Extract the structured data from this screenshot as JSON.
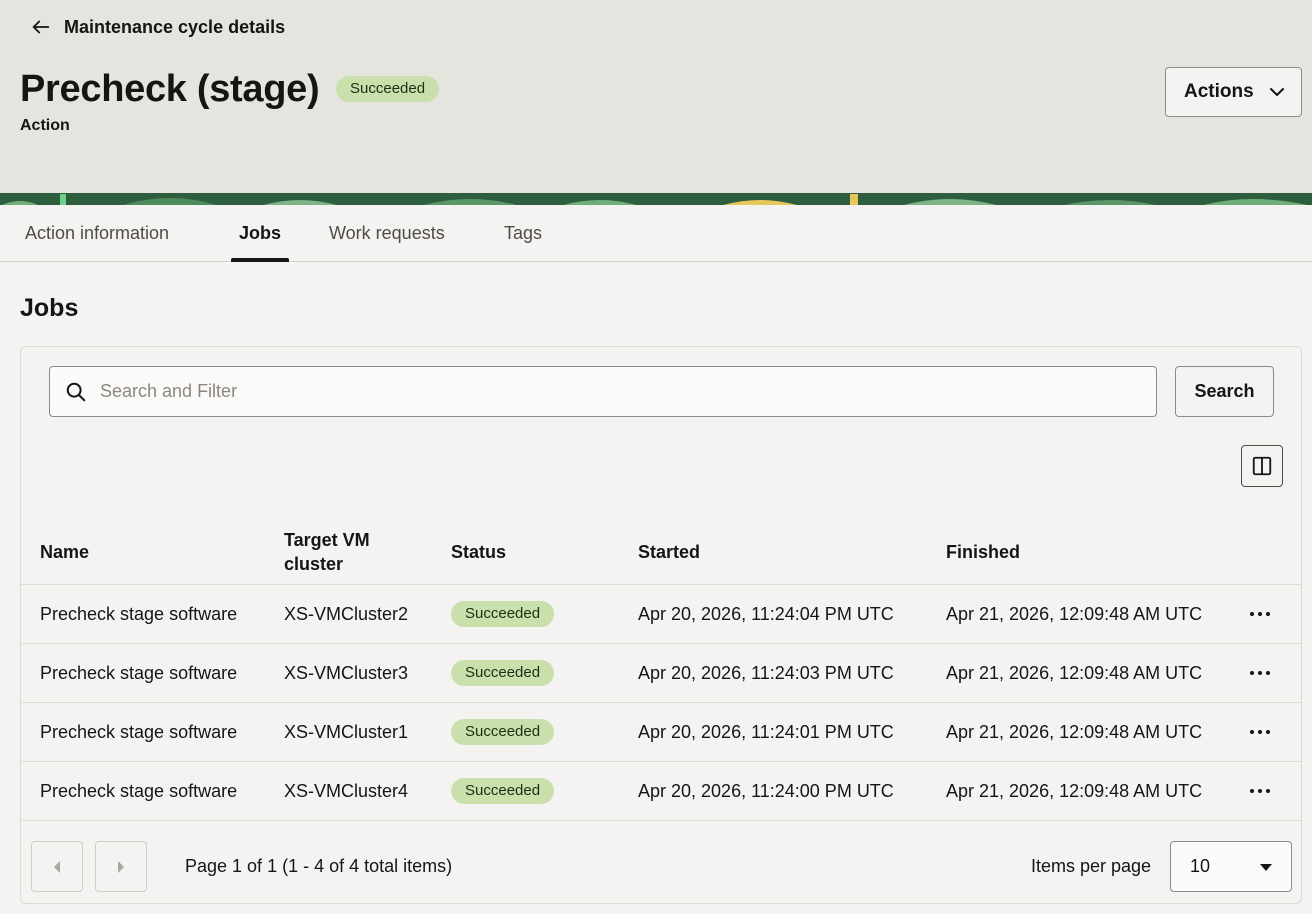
{
  "header": {
    "back_label": "Maintenance cycle details",
    "title": "Precheck (stage)",
    "status_badge": "Succeeded",
    "subtitle": "Action",
    "actions_label": "Actions"
  },
  "tabs": [
    {
      "label": "Action information",
      "active": false
    },
    {
      "label": "Jobs",
      "active": true
    },
    {
      "label": "Work requests",
      "active": false
    },
    {
      "label": "Tags",
      "active": false
    }
  ],
  "section_title": "Jobs",
  "search": {
    "placeholder": "Search and Filter",
    "value": "",
    "button_label": "Search"
  },
  "table": {
    "columns": [
      "Name",
      "Target VM cluster",
      "Status",
      "Started",
      "Finished"
    ],
    "rows": [
      {
        "name": "Precheck stage software",
        "target": "XS-VMCluster2",
        "status": "Succeeded",
        "started": "Apr 20, 2026, 11:24:04 PM UTC",
        "finished": "Apr 21, 2026, 12:09:48 AM UTC"
      },
      {
        "name": "Precheck stage software",
        "target": "XS-VMCluster3",
        "status": "Succeeded",
        "started": "Apr 20, 2026, 11:24:03 PM UTC",
        "finished": "Apr 21, 2026, 12:09:48 AM UTC"
      },
      {
        "name": "Precheck stage software",
        "target": "XS-VMCluster1",
        "status": "Succeeded",
        "started": "Apr 20, 2026, 11:24:01 PM UTC",
        "finished": "Apr 21, 2026, 12:09:48 AM UTC"
      },
      {
        "name": "Precheck stage software",
        "target": "XS-VMCluster4",
        "status": "Succeeded",
        "started": "Apr 20, 2026, 11:24:00 PM UTC",
        "finished": "Apr 21, 2026, 12:09:48 AM UTC"
      }
    ]
  },
  "pagination": {
    "info": "Page 1 of 1 (1 - 4 of 4 total items)",
    "items_per_page_label": "Items per page",
    "items_per_page_value": "10"
  },
  "colors": {
    "success_badge_bg": "#c9e0ad",
    "header_bg": "#e6e4df",
    "page_bg": "#f4f3f1"
  }
}
